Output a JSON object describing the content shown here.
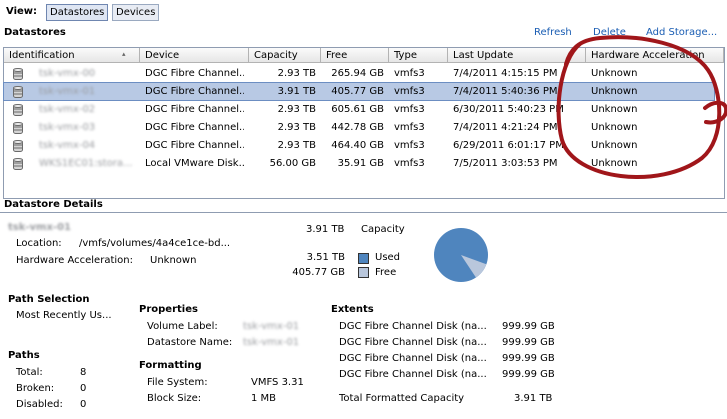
{
  "toolbar": {
    "view_label": "View:",
    "datastores_label": "Datastores",
    "devices_label": "Devices"
  },
  "datastores": {
    "title": "Datastores",
    "actions": {
      "refresh": "Refresh",
      "delete": "Delete",
      "add_storage": "Add Storage..."
    },
    "columns": [
      "Identification",
      "Device",
      "Capacity",
      "Free",
      "Type",
      "Last Update",
      "Hardware Acceleration"
    ],
    "rows": [
      {
        "identification": "tsk-vmx-00",
        "device": "DGC Fibre Channel...",
        "capacity": "2.93 TB",
        "free": "265.94 GB",
        "type": "vmfs3",
        "last_update": "7/4/2011 4:15:15 PM",
        "hw_accel": "Unknown"
      },
      {
        "identification": "tsk-vmx-01",
        "device": "DGC Fibre Channel...",
        "capacity": "3.91 TB",
        "free": "405.77 GB",
        "type": "vmfs3",
        "last_update": "7/4/2011 5:40:36 PM",
        "hw_accel": "Unknown"
      },
      {
        "identification": "tsk-vmx-02",
        "device": "DGC Fibre Channel...",
        "capacity": "2.93 TB",
        "free": "605.61 GB",
        "type": "vmfs3",
        "last_update": "6/30/2011 5:40:23 PM",
        "hw_accel": "Unknown"
      },
      {
        "identification": "tsk-vmx-03",
        "device": "DGC Fibre Channel...",
        "capacity": "2.93 TB",
        "free": "442.78 GB",
        "type": "vmfs3",
        "last_update": "7/4/2011 4:21:24 PM",
        "hw_accel": "Unknown"
      },
      {
        "identification": "tsk-vmx-04",
        "device": "DGC Fibre Channel...",
        "capacity": "2.93 TB",
        "free": "464.40 GB",
        "type": "vmfs3",
        "last_update": "6/29/2011 6:01:17 PM",
        "hw_accel": "Unknown"
      },
      {
        "identification": "WKS1EC01:stora...",
        "device": "Local VMware Disk...",
        "capacity": "56.00 GB",
        "free": "35.91 GB",
        "type": "vmfs3",
        "last_update": "7/5/2011 3:03:53 PM",
        "hw_accel": "Unknown"
      }
    ]
  },
  "details": {
    "title": "Datastore Details",
    "name": "tsk-vmx-01",
    "capacity_value": "3.91 TB",
    "capacity_label": "Capacity",
    "location_label": "Location:",
    "location_value": "/vmfs/volumes/4a4ce1ce-bd...",
    "hw_accel_label": "Hardware Acceleration:",
    "hw_accel_value": "Unknown",
    "used_value": "3.51 TB",
    "used_label": "Used",
    "free_value": "405.77 GB",
    "free_label": "Free",
    "used_fraction": 0.899,
    "used_color": "#4f85be",
    "free_color": "#b9c7dc",
    "path_selection_title": "Path Selection",
    "path_selection_value": "Most Recently Us...",
    "paths_title": "Paths",
    "paths": [
      {
        "label": "Total:",
        "value": "8"
      },
      {
        "label": "Broken:",
        "value": "0"
      },
      {
        "label": "Disabled:",
        "value": "0"
      }
    ],
    "properties_title": "Properties",
    "volume_label_label": "Volume Label:",
    "volume_label_value": "tsk-vmx-01",
    "datastore_name_label": "Datastore Name:",
    "datastore_name_value": "tsk-vmx-01",
    "formatting_title": "Formatting",
    "file_system_label": "File System:",
    "file_system_value": "VMFS 3.31",
    "block_size_label": "Block Size:",
    "block_size_value": "1 MB",
    "extents_title": "Extents",
    "extents": [
      {
        "name": "DGC Fibre Channel Disk (na...",
        "size": "999.99 GB"
      },
      {
        "name": "DGC Fibre Channel Disk (na...",
        "size": "999.99 GB"
      },
      {
        "name": "DGC Fibre Channel Disk (na...",
        "size": "999.99 GB"
      },
      {
        "name": "DGC Fibre Channel Disk (na...",
        "size": "999.99 GB"
      }
    ],
    "total_capacity_label": "Total Formatted Capacity",
    "total_capacity_value": "3.91 TB"
  },
  "annotation": {
    "color": "#a0161a"
  }
}
